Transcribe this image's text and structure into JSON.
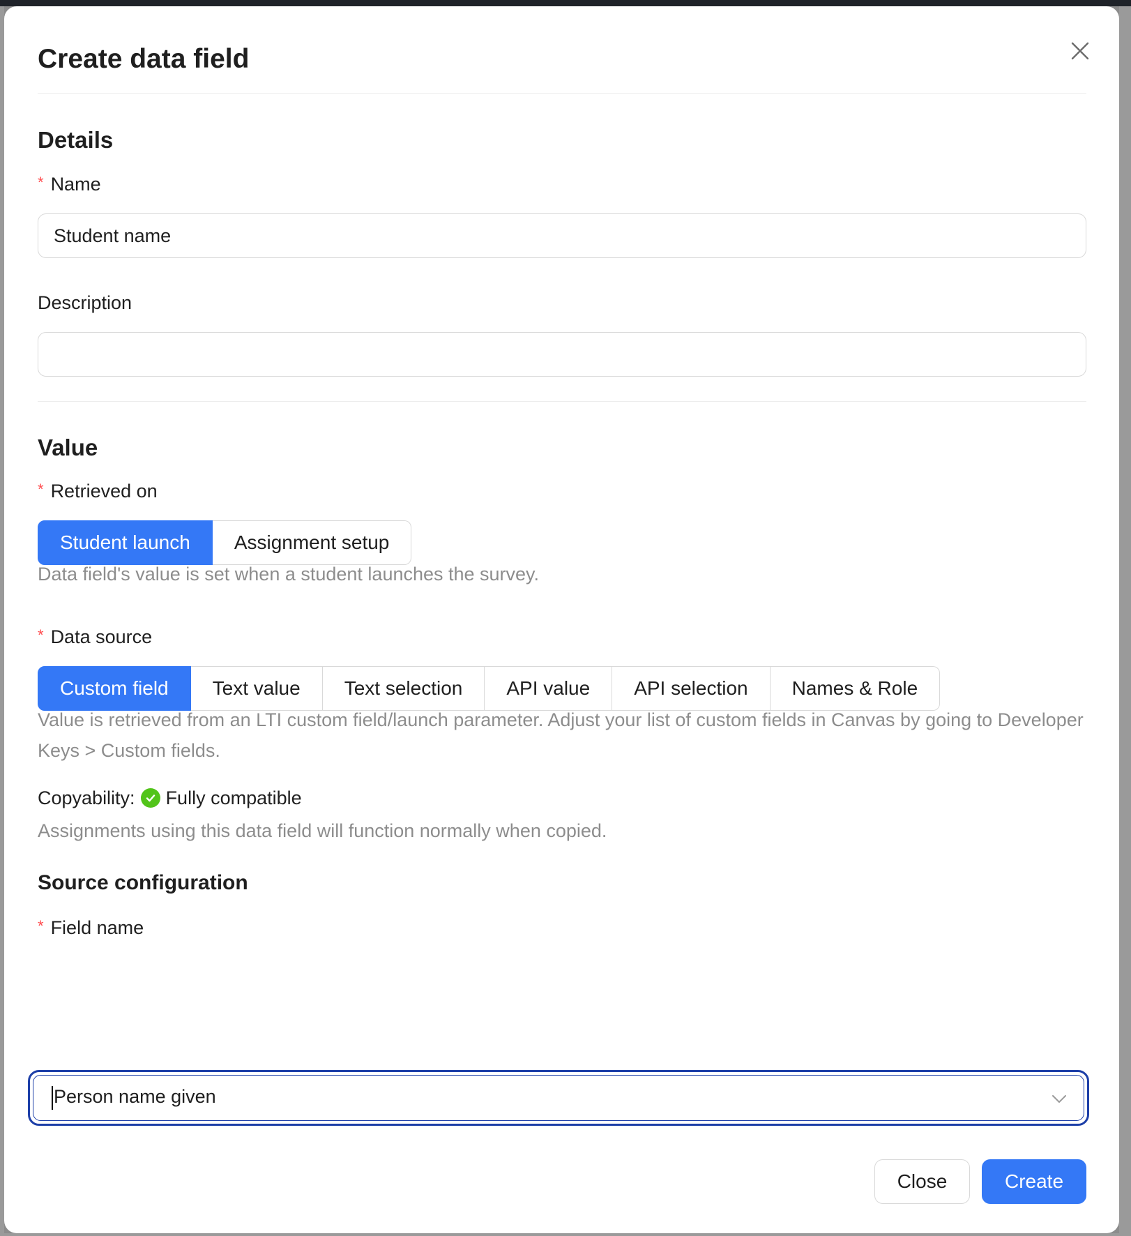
{
  "modal": {
    "title": "Create data field",
    "close_icon": "close-icon"
  },
  "details": {
    "section_title": "Details",
    "name": {
      "label": "Name",
      "required_mark": "*",
      "value": "Student name"
    },
    "description": {
      "label": "Description",
      "value": ""
    }
  },
  "value": {
    "section_title": "Value",
    "retrieved_on": {
      "required_mark": "*",
      "label": "Retrieved on",
      "options": [
        "Student launch",
        "Assignment setup"
      ],
      "selected": "Student launch",
      "help": "Data field's value is set when a student launches the survey."
    },
    "data_source": {
      "required_mark": "*",
      "label": "Data source",
      "options": [
        "Custom field",
        "Text value",
        "Text selection",
        "API value",
        "API selection",
        "Names & Role"
      ],
      "selected": "Custom field",
      "help": "Value is retrieved from an LTI custom field/launch parameter. Adjust your list of custom fields in Canvas by going to Developer Keys > Custom fields."
    },
    "copyability": {
      "label": "Copyability:",
      "status": "Fully compatible",
      "status_icon": "check-circle-icon",
      "help": "Assignments using this data field will function normally when copied."
    }
  },
  "source_config": {
    "section_title": "Source configuration",
    "field_name": {
      "required_mark": "*",
      "label": "Field name",
      "value": "Person name given",
      "dropdown_icon": "chevron-down-icon"
    }
  },
  "footer": {
    "close_label": "Close",
    "create_label": "Create"
  },
  "colors": {
    "primary": "#3478f6",
    "required": "#ff4d4f",
    "success": "#52c41a",
    "focus_ring": "#1d3fa8"
  }
}
